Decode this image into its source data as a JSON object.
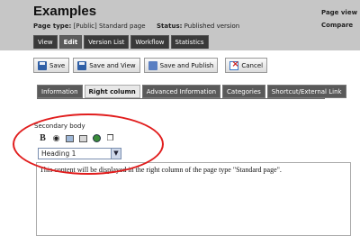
{
  "header": {
    "title": "Examples",
    "page_type_label": "Page type:",
    "page_type_value": "[Public] Standard page",
    "status_label": "Status:",
    "status_value": "Published version",
    "right_link_1": "Page view",
    "right_link_2": "Compare"
  },
  "tabs": [
    "View",
    "Edit",
    "Version List",
    "Workflow",
    "Statistics"
  ],
  "toolbar": {
    "save_label": "Save",
    "save_view_label": "Save and View",
    "save_publish_label": "Save and Publish",
    "cancel_label": "Cancel"
  },
  "subtabs": [
    "Information",
    "Right column",
    "Advanced Information",
    "Categories",
    "Shortcut/External Link"
  ],
  "editor": {
    "section_label": "Secondary body",
    "format_value": "Heading 1",
    "content_text": "This content will be displayed in the right column of the page type \"Standard page\".",
    "tools": [
      "bold-icon",
      "binoculars-icon",
      "image-icon",
      "document-icon",
      "globe-icon",
      "window-icon"
    ]
  },
  "annotation": {
    "oval_color": "#e11d1d"
  }
}
